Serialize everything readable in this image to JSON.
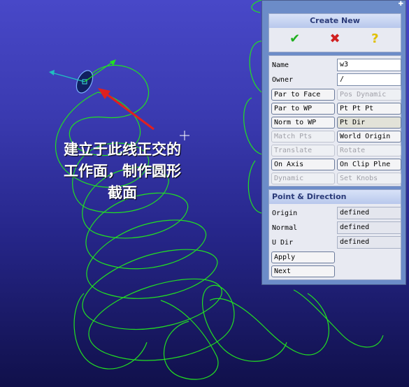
{
  "annotation": {
    "line1": "建立于此线正交的",
    "line2": "工作面，制作圆形",
    "line3": "截面"
  },
  "panel": {
    "title": "Create New",
    "toolbar": {
      "ok_icon": "check-icon",
      "cancel_icon": "cross-icon",
      "help_icon": "help-icon"
    },
    "name_label": "Name",
    "name_value": "w3",
    "owner_label": "Owner",
    "owner_value": "/",
    "buttons": [
      {
        "label": "Par to Face",
        "state": "enabled"
      },
      {
        "label": "Pos Dynamic",
        "state": "disabled"
      },
      {
        "label": "Par to WP",
        "state": "enabled"
      },
      {
        "label": "Pt Pt Pt",
        "state": "enabled"
      },
      {
        "label": "Norm to WP",
        "state": "enabled"
      },
      {
        "label": "Pt Dir",
        "state": "active"
      },
      {
        "label": "Match Pts",
        "state": "disabled"
      },
      {
        "label": "World Origin",
        "state": "enabled"
      },
      {
        "label": "Translate",
        "state": "disabled"
      },
      {
        "label": "Rotate",
        "state": "disabled"
      },
      {
        "label": "On Axis",
        "state": "enabled"
      },
      {
        "label": "On Clip Plne",
        "state": "enabled"
      },
      {
        "label": "Dynamic",
        "state": "disabled"
      },
      {
        "label": "Set Knobs",
        "state": "disabled"
      }
    ],
    "pd_title": "Point & Direction",
    "origin_label": "Origin",
    "origin_value": "defined",
    "normal_label": "Normal",
    "normal_value": "defined",
    "udir_label": "U Dir",
    "udir_value": "defined",
    "apply_label": "Apply",
    "next_label": "Next"
  },
  "colors": {
    "curve": "#22e022",
    "arrow": "#e02020",
    "ok": "#20b020",
    "cancel": "#d02020",
    "help": "#e0c000"
  }
}
